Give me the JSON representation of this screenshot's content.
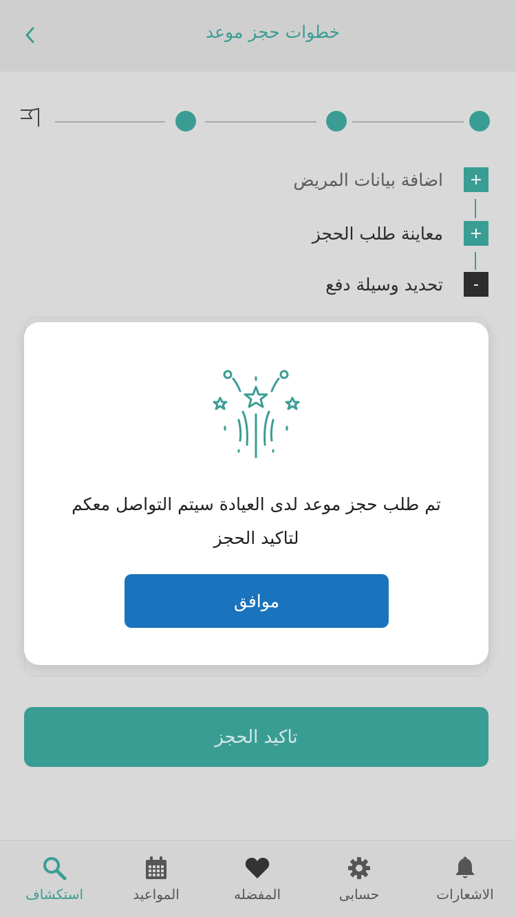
{
  "header": {
    "title": "خطوات حجز موعد"
  },
  "steps": [
    {
      "label": "اضافة بيانات المريض",
      "icon": "+",
      "state": "collapsed"
    },
    {
      "label": "معاينة طلب الحجز",
      "icon": "+",
      "state": "collapsed"
    },
    {
      "label": "تحديد وسيلة دفع",
      "icon": "-",
      "state": "expanded"
    }
  ],
  "modal": {
    "message": "تم طلب حجز موعد لدى العيادة سيتم التواصل معكم لتاكيد الحجز",
    "ok_label": "موافق"
  },
  "confirm_label": "تاكيد الحجز",
  "nav": [
    {
      "label": "استكشاف",
      "icon": "search-icon",
      "active": true
    },
    {
      "label": "المواعيد",
      "icon": "calendar-icon",
      "active": false
    },
    {
      "label": "المفضله",
      "icon": "heart-icon",
      "active": false
    },
    {
      "label": "حسابى",
      "icon": "gear-icon",
      "active": false
    },
    {
      "label": "الاشعارات",
      "icon": "bell-icon",
      "active": false
    }
  ],
  "colors": {
    "accent": "#3a9d94",
    "primary_button": "#1a73bd",
    "overlay_background": "#d9d9d9"
  }
}
